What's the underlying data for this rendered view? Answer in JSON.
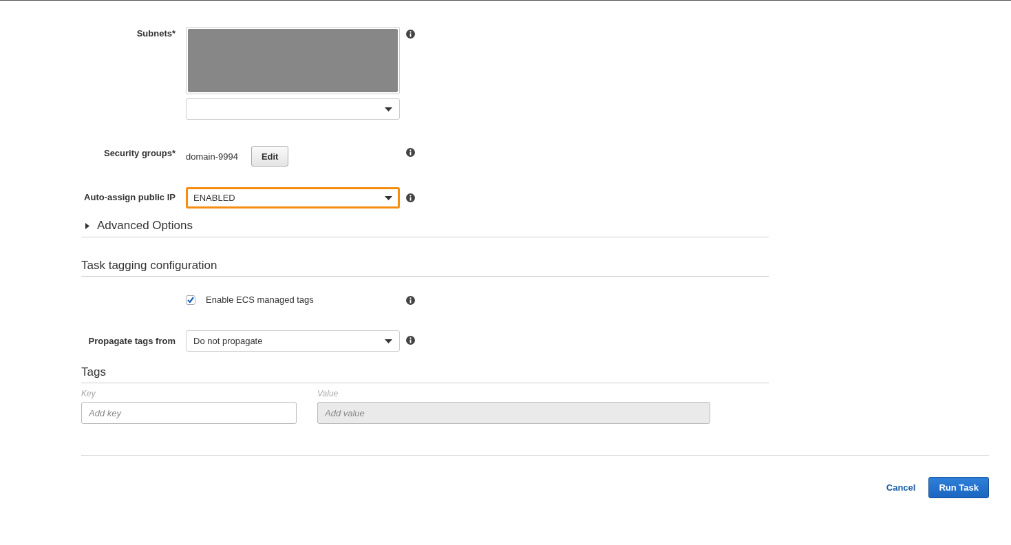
{
  "network": {
    "subnets": {
      "label": "Subnets*"
    },
    "security_groups": {
      "label": "Security groups*",
      "value": "domain-9994",
      "button": "Edit"
    },
    "auto_assign_ip": {
      "label": "Auto-assign public IP",
      "value": "ENABLED",
      "highlighted": true
    }
  },
  "advanced_options": {
    "label": "Advanced Options",
    "expanded": false
  },
  "task_tagging": {
    "title": "Task tagging configuration",
    "managed_tags": {
      "label": "Enable ECS managed tags",
      "checked": true
    },
    "propagate": {
      "label": "Propagate tags from",
      "value": "Do not propagate"
    }
  },
  "tags": {
    "title": "Tags",
    "key_column": "Key",
    "value_column": "Value",
    "key_field": {
      "placeholder": "Add key",
      "disabled": false
    },
    "value_field": {
      "placeholder": "Add value",
      "disabled": true
    }
  },
  "footer": {
    "cancel": "Cancel",
    "submit": "Run Task"
  }
}
